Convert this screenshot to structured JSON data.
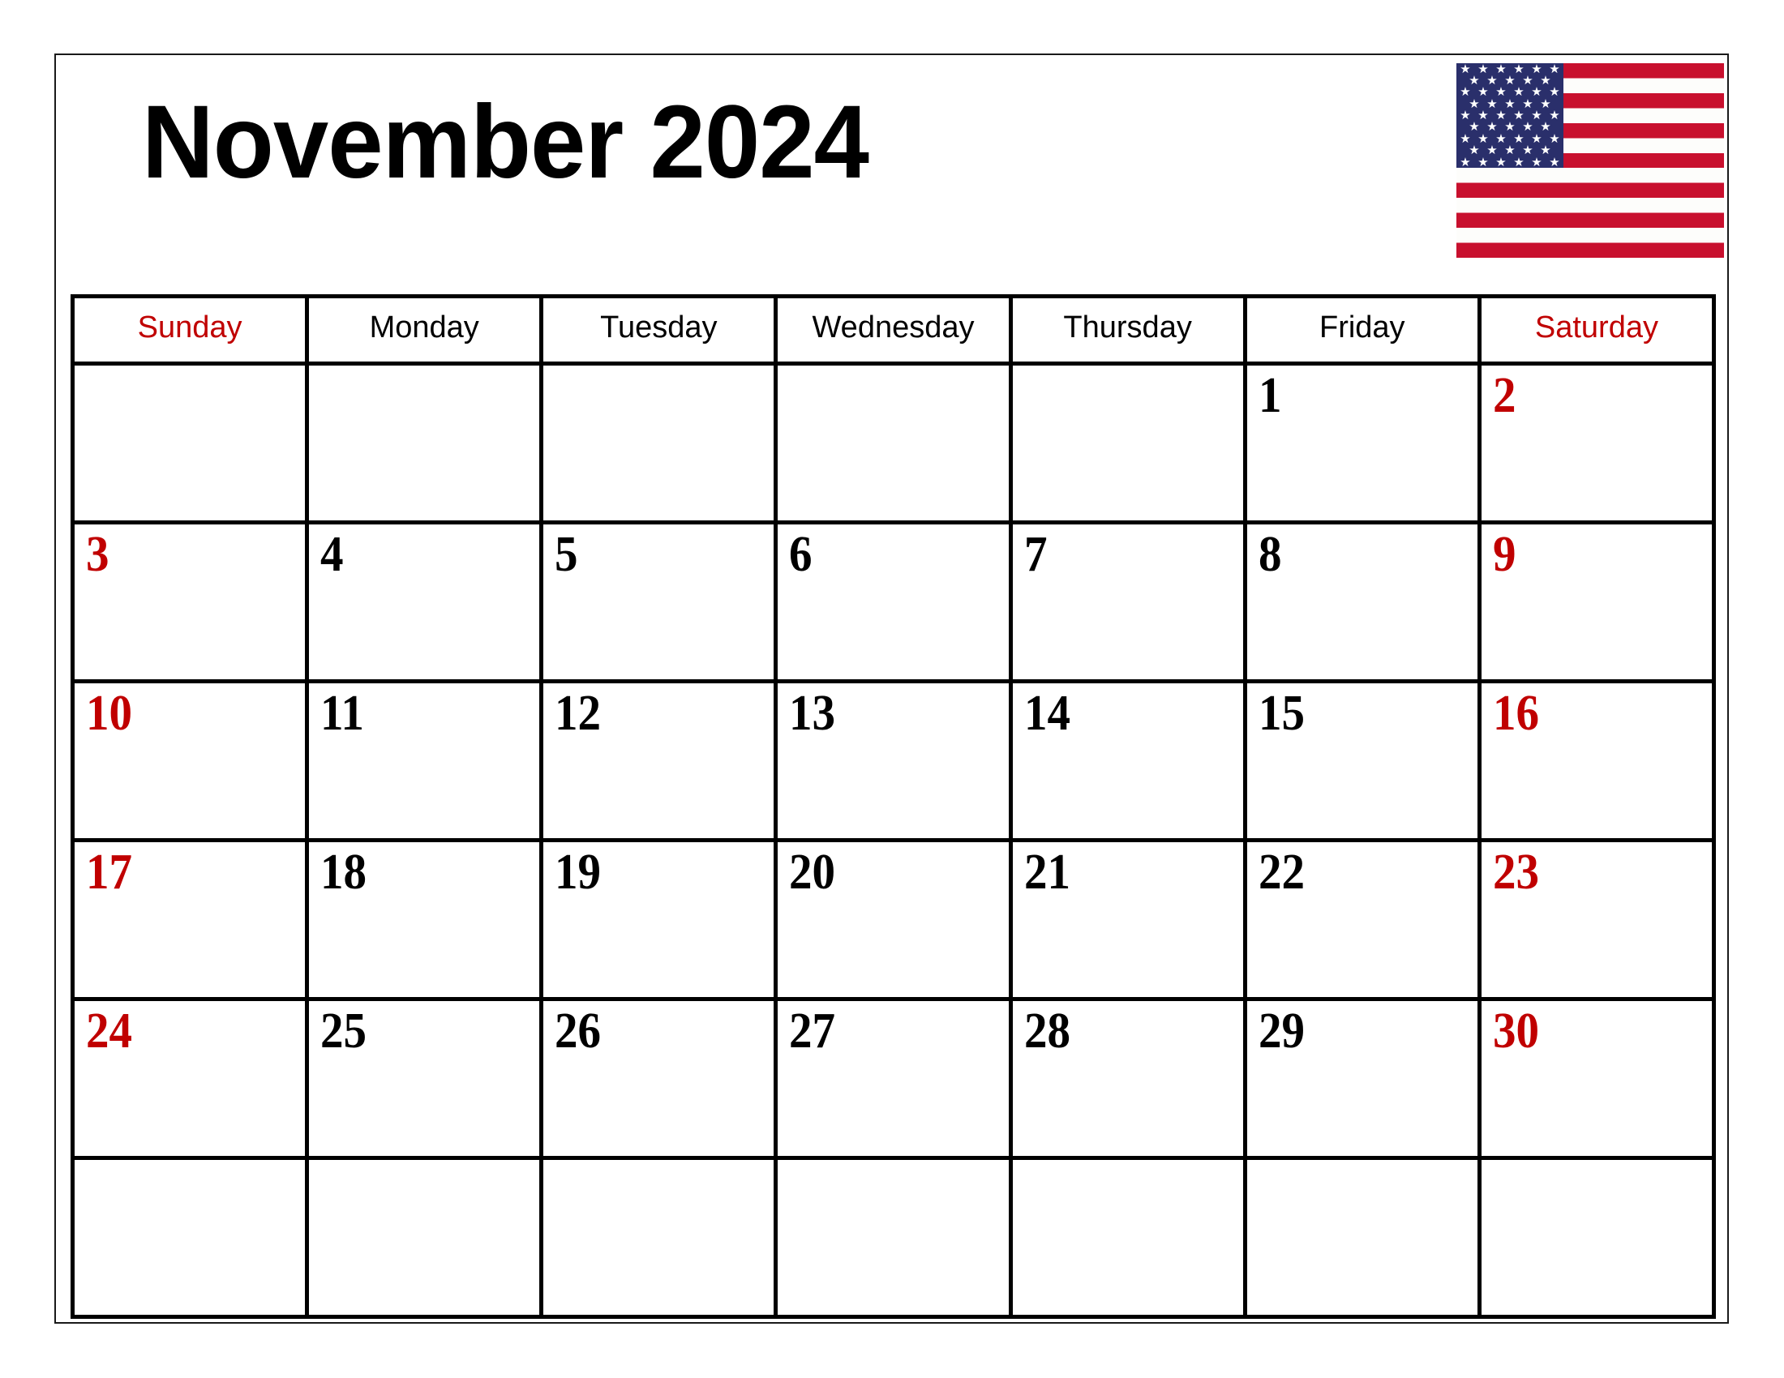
{
  "document": {
    "title": "November 2024",
    "month_name": "November",
    "year": "2024"
  },
  "flag": {
    "name": "united-states-flag",
    "colors": {
      "red": "#C8102E",
      "white": "#FDFDFB",
      "blue": "#2A2F6B"
    },
    "stripe_count": 13,
    "star_count": 50
  },
  "colors": {
    "weekend_text": "#C00000",
    "weekday_text": "#000000",
    "grid_line": "#000000",
    "page_border": "#1A1A1A",
    "background": "#FFFFFF"
  },
  "calendar": {
    "weekday_headers": [
      {
        "label": "Sunday",
        "weekend": true
      },
      {
        "label": "Monday",
        "weekend": false
      },
      {
        "label": "Tuesday",
        "weekend": false
      },
      {
        "label": "Wednesday",
        "weekend": false
      },
      {
        "label": "Thursday",
        "weekend": false
      },
      {
        "label": "Friday",
        "weekend": false
      },
      {
        "label": "Saturday",
        "weekend": true
      }
    ],
    "weeks": [
      [
        {
          "day": "",
          "weekend": true,
          "empty": true
        },
        {
          "day": "",
          "weekend": false,
          "empty": true
        },
        {
          "day": "",
          "weekend": false,
          "empty": true
        },
        {
          "day": "",
          "weekend": false,
          "empty": true
        },
        {
          "day": "",
          "weekend": false,
          "empty": true
        },
        {
          "day": "1",
          "weekend": false,
          "empty": false
        },
        {
          "day": "2",
          "weekend": true,
          "empty": false
        }
      ],
      [
        {
          "day": "3",
          "weekend": true,
          "empty": false
        },
        {
          "day": "4",
          "weekend": false,
          "empty": false
        },
        {
          "day": "5",
          "weekend": false,
          "empty": false
        },
        {
          "day": "6",
          "weekend": false,
          "empty": false
        },
        {
          "day": "7",
          "weekend": false,
          "empty": false
        },
        {
          "day": "8",
          "weekend": false,
          "empty": false
        },
        {
          "day": "9",
          "weekend": true,
          "empty": false
        }
      ],
      [
        {
          "day": "10",
          "weekend": true,
          "empty": false
        },
        {
          "day": "11",
          "weekend": false,
          "empty": false
        },
        {
          "day": "12",
          "weekend": false,
          "empty": false
        },
        {
          "day": "13",
          "weekend": false,
          "empty": false
        },
        {
          "day": "14",
          "weekend": false,
          "empty": false
        },
        {
          "day": "15",
          "weekend": false,
          "empty": false
        },
        {
          "day": "16",
          "weekend": true,
          "empty": false
        }
      ],
      [
        {
          "day": "17",
          "weekend": true,
          "empty": false
        },
        {
          "day": "18",
          "weekend": false,
          "empty": false
        },
        {
          "day": "19",
          "weekend": false,
          "empty": false
        },
        {
          "day": "20",
          "weekend": false,
          "empty": false
        },
        {
          "day": "21",
          "weekend": false,
          "empty": false
        },
        {
          "day": "22",
          "weekend": false,
          "empty": false
        },
        {
          "day": "23",
          "weekend": true,
          "empty": false
        }
      ],
      [
        {
          "day": "24",
          "weekend": true,
          "empty": false
        },
        {
          "day": "25",
          "weekend": false,
          "empty": false
        },
        {
          "day": "26",
          "weekend": false,
          "empty": false
        },
        {
          "day": "27",
          "weekend": false,
          "empty": false
        },
        {
          "day": "28",
          "weekend": false,
          "empty": false
        },
        {
          "day": "29",
          "weekend": false,
          "empty": false
        },
        {
          "day": "30",
          "weekend": true,
          "empty": false
        }
      ],
      [
        {
          "day": "",
          "weekend": true,
          "empty": true
        },
        {
          "day": "",
          "weekend": false,
          "empty": true
        },
        {
          "day": "",
          "weekend": false,
          "empty": true
        },
        {
          "day": "",
          "weekend": false,
          "empty": true
        },
        {
          "day": "",
          "weekend": false,
          "empty": true
        },
        {
          "day": "",
          "weekend": false,
          "empty": true
        },
        {
          "day": "",
          "weekend": true,
          "empty": true
        }
      ]
    ]
  }
}
